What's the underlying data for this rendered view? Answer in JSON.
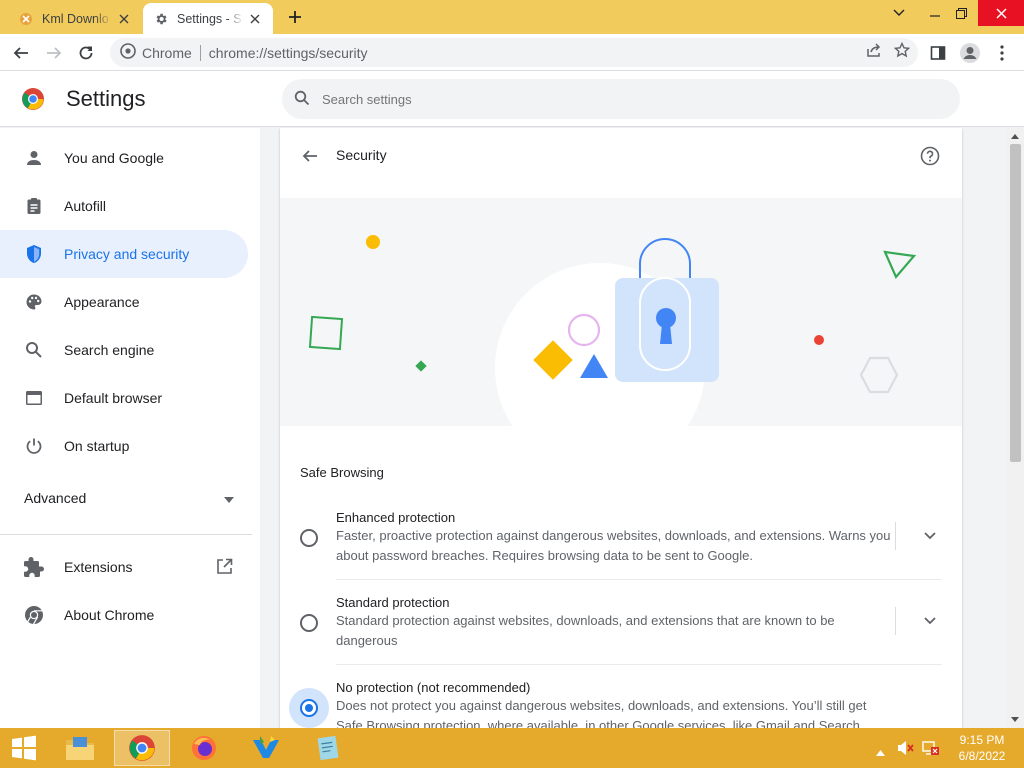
{
  "tabs": [
    {
      "title": "Kml Downlo",
      "icon": "kml-favicon",
      "active": false
    },
    {
      "title": "Settings - Se",
      "icon": "gear-icon",
      "active": true
    }
  ],
  "omnibox": {
    "site_label": "Chrome",
    "url": "chrome://settings/security"
  },
  "settings": {
    "title": "Settings",
    "search_placeholder": "Search settings"
  },
  "sidebar": {
    "items": [
      {
        "label": "You and Google",
        "icon": "person-icon"
      },
      {
        "label": "Autofill",
        "icon": "clipboard-icon"
      },
      {
        "label": "Privacy and security",
        "icon": "shield-icon",
        "selected": true
      },
      {
        "label": "Appearance",
        "icon": "palette-icon"
      },
      {
        "label": "Search engine",
        "icon": "search-icon"
      },
      {
        "label": "Default browser",
        "icon": "browser-icon"
      },
      {
        "label": "On startup",
        "icon": "power-icon"
      }
    ],
    "advanced": "Advanced",
    "extensions": "Extensions",
    "about": "About Chrome"
  },
  "page": {
    "title": "Security",
    "section": "Safe Browsing",
    "options": [
      {
        "title": "Enhanced protection",
        "description": "Faster, proactive protection against dangerous websites, downloads, and extensions. Warns you about password breaches. Requires browsing data to be sent to Google.",
        "checked": false
      },
      {
        "title": "Standard protection",
        "description": "Standard protection against websites, downloads, and extensions that are known to be dangerous",
        "checked": false
      },
      {
        "title": "No protection (not recommended)",
        "description": "Does not protect you against dangerous websites, downloads, and extensions. You’ll still get Safe Browsing protection, where available, in other Google services, like Gmail and Search.",
        "checked": true
      }
    ]
  },
  "taskbar": {
    "time": "9:15 PM",
    "date": "6/8/2022"
  },
  "colors": {
    "accent": "#1a73e8",
    "titlebar": "#f2cb5d",
    "taskbar": "#e5a92c",
    "selected_bg": "#e8f0fe"
  }
}
